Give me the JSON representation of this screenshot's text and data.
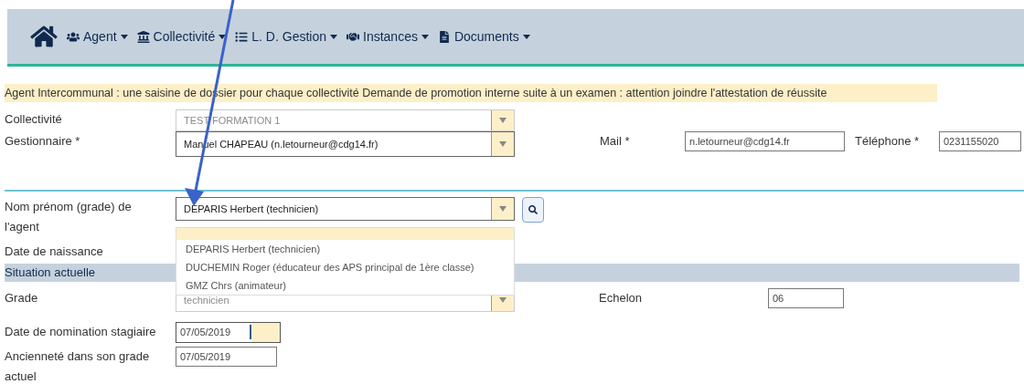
{
  "nav": {
    "items": [
      {
        "label": "Agent"
      },
      {
        "label": "Collectivité"
      },
      {
        "label": "L. D. Gestion"
      },
      {
        "label": "Instances"
      },
      {
        "label": "Documents"
      }
    ]
  },
  "notice": "Agent Intercommunal : une saisine de dossier pour chaque collectivité Demande de promotion interne suite à un examen : attention joindre l'attestation de réussite",
  "collectivite": {
    "label": "Collectivité",
    "value": "TEST FORMATION 1",
    "disabled": true
  },
  "gestionnaire": {
    "label": "Gestionnaire *",
    "value": "Manuel CHAPEAU (n.letourneur@cdg14.fr)",
    "disabled": false
  },
  "mail": {
    "label": "Mail *",
    "value": "n.letourneur@cdg14.fr"
  },
  "telephone": {
    "label": "Téléphone *",
    "value": "0231155020"
  },
  "agent": {
    "label": "Nom prénom (grade) de l'agent",
    "value": "DEPARIS Herbert (technicien)",
    "disabled": false,
    "options": [
      "DEPARIS Herbert (technicien)",
      "DUCHEMIN Roger (éducateur des APS principal de 1ère classe)",
      "GMZ Chrs (animateur)"
    ]
  },
  "date_naissance": {
    "label": "Date de naissance"
  },
  "section": "Situation actuelle",
  "grade": {
    "label": "Grade",
    "value": "technicien",
    "disabled": true
  },
  "echelon": {
    "label": "Echelon",
    "value": "06"
  },
  "date_nomination": {
    "label": "Date de nomination stagiaire",
    "value": "07/05/2019"
  },
  "anciennete": {
    "label": "Ancienneté dans son grade actuel",
    "value": "07/05/2019"
  }
}
